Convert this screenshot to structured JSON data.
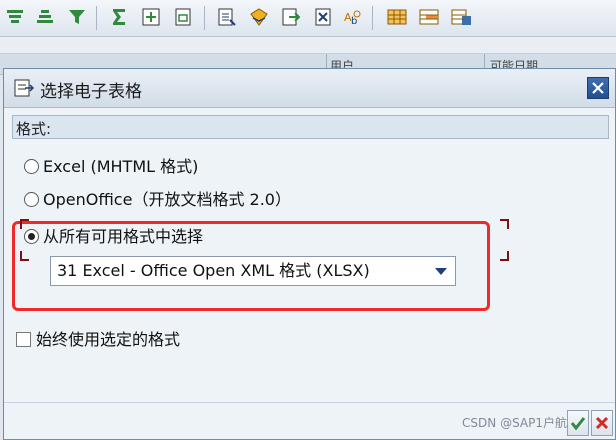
{
  "toolbar": {
    "icons": [
      "sort-ascending-icon",
      "sort-descending-icon",
      "filter-icon",
      "sum-icon",
      "subtotal-icon",
      "print-preview-icon",
      "export-icon",
      "mail-icon",
      "abc-icon",
      "spreadsheet-icon",
      "find-icon",
      "layout-icon",
      "grid-layout-icon",
      "change-layout-icon",
      "save-layout-icon"
    ]
  },
  "background": {
    "column_headers": [
      "用户",
      "可能日期"
    ]
  },
  "dialog": {
    "title": "选择电子表格",
    "group_title": "格式:",
    "options": [
      {
        "label": "Excel (MHTML 格式)",
        "selected": false
      },
      {
        "label": "OpenOffice（开放文档格式 2.0）",
        "selected": false
      },
      {
        "label": "从所有可用格式中选择",
        "selected": true
      }
    ],
    "format_select": {
      "value": "31 Excel - Office Open XML 格式 (XLSX)"
    },
    "always_use_label": "始终使用选定的格式",
    "always_use_checked": false
  },
  "watermark": "CSDN @SAP1户航",
  "colors": {
    "highlight": "#ee2a2a",
    "title_bg": "#d2dde8",
    "close_button": "#234f8f"
  }
}
